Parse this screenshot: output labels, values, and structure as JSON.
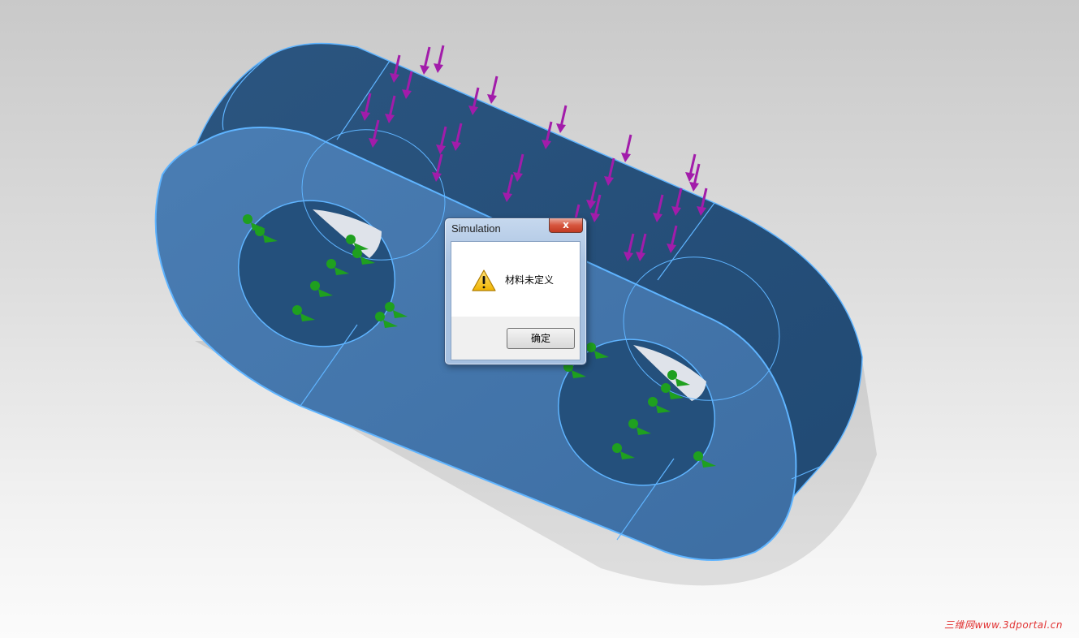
{
  "dialog": {
    "title": "Simulation",
    "close_glyph": "x",
    "message": "材料未定义",
    "ok_label": "确定",
    "icon": "warning-icon"
  },
  "viewport": {
    "model": "block-with-two-holes",
    "body_color": "#3f72a8",
    "dark_face_color": "#254a72",
    "edge_color": "#5fb4ff",
    "load_arrow_color": "#a21caa",
    "constraint_color": "#1fa01f"
  },
  "watermark": {
    "text": "三维网www.3dportal.cn",
    "color": "#e03030"
  }
}
